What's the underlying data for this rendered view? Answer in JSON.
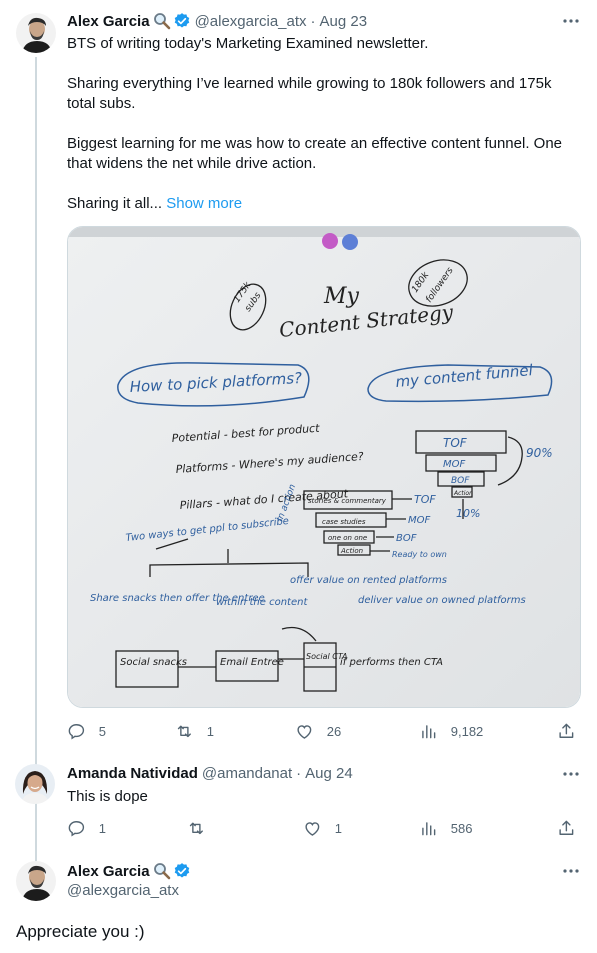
{
  "tweet1": {
    "author_name": "Alex Garcia",
    "author_emoji": "magnifier-icon",
    "handle": "@alexgarcia_atx",
    "separator": "·",
    "date": "Aug 23",
    "paragraphs": [
      "BTS of writing today's Marketing Examined newsletter.",
      "Sharing everything I’ve learned while growing to 180k followers and 175k total subs.",
      "Biggest learning for me was how to create an effective content funnel. One that widens the net while drive action."
    ],
    "truncated_text": "Sharing it all...",
    "show_more": "Show more",
    "whiteboard": {
      "title_line1": "My",
      "title_line2": "Content Strategy",
      "subs_note_1": "175k",
      "subs_note_2": "subs",
      "followers_note_1": "180k",
      "followers_note_2": "followers",
      "left_header": "How to pick platforms?",
      "right_header": "my content funnel",
      "potential": "Potential - best for product",
      "platforms": "Platforms - Where's my audience?",
      "pillars": "Pillars - what do I create about",
      "two_ways": "Two ways to get ppl to subscribe",
      "share_snacks": "Share snacks then offer the entree",
      "within_content": "within the content",
      "offer_value": "offer value on rented platforms",
      "deliver_value": "deliver value on owned platforms",
      "tof": "TOF",
      "mof": "MOF",
      "bof": "BOF",
      "percent_90": "90%",
      "percent_10": "10%",
      "stories": "stories & commentary",
      "case_studies": "case studies",
      "one_on_one": "one on one",
      "action": "Action",
      "ready_to_own": "Ready to own",
      "in_action": "In action",
      "social": "Social snacks",
      "email": "Email Entree",
      "social_cta": "Social CTA",
      "if_performs": "if performs then CTA"
    },
    "stats": {
      "replies": "5",
      "reposts": "1",
      "likes": "26",
      "views": "9,182"
    }
  },
  "reply1": {
    "author_name": "Amanda Natividad",
    "handle": "@amandanat",
    "separator": "·",
    "date": "Aug 24",
    "text": "This is dope",
    "stats": {
      "replies": "1",
      "reposts": "",
      "likes": "1",
      "views": "586"
    }
  },
  "reply2": {
    "author_name": "Alex Garcia",
    "author_emoji": "magnifier-icon",
    "handle": "@alexgarcia_atx",
    "text": "Appreciate you :)"
  },
  "colors": {
    "text": "#0f1419",
    "secondary": "#536471",
    "link": "#1d9bf0",
    "verified": "#1d9bf0",
    "thread_line": "#cfd9de",
    "whiteboard": "#e9ebec",
    "marker_blue": "#2f5f9e",
    "marker_black": "#222222"
  }
}
